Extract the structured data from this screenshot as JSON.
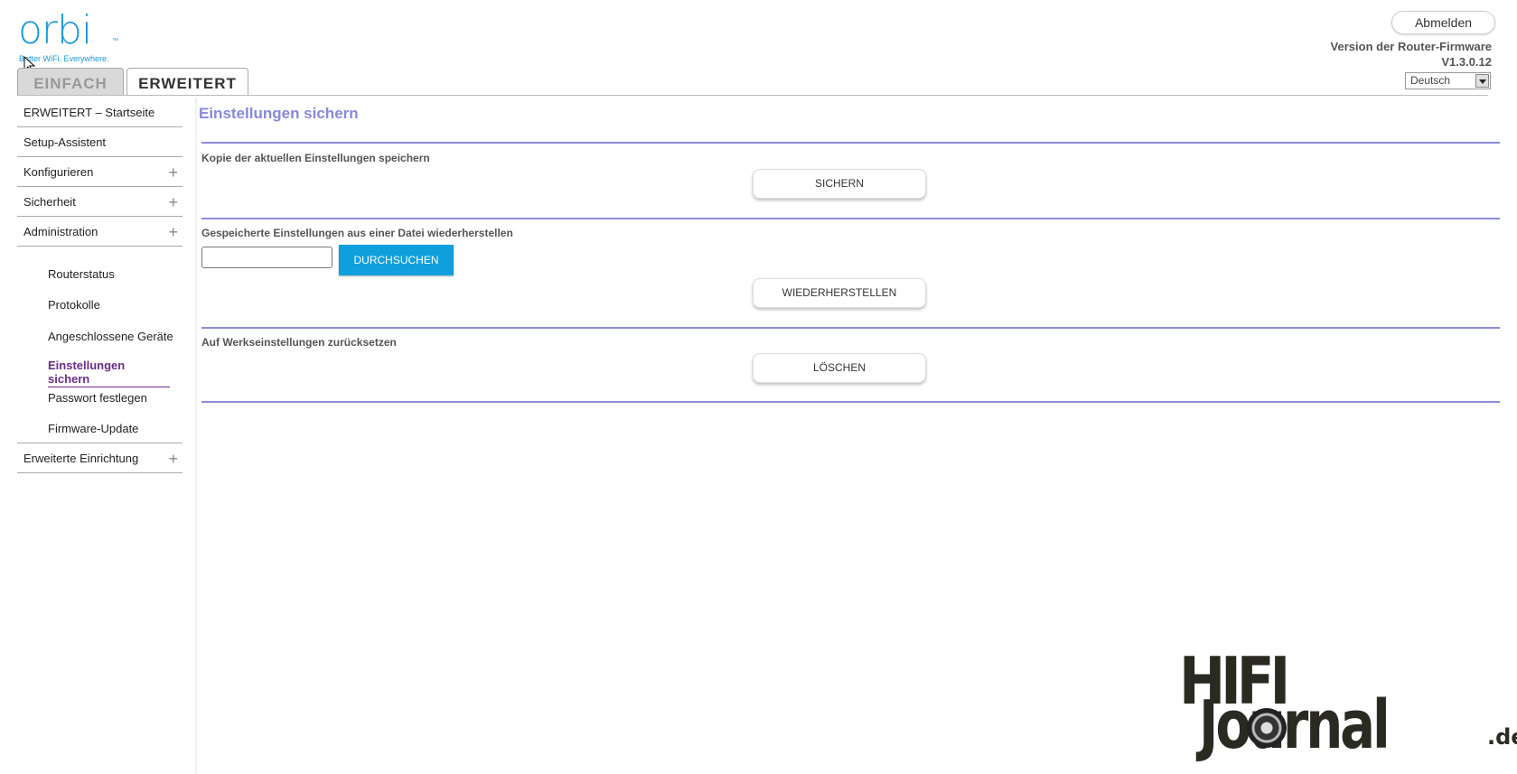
{
  "header": {
    "logo_text": "orbi",
    "logo_tm": "™",
    "logo_tagline": "Better WiFi. Everywhere.",
    "tabs": [
      {
        "label": "EINFACH",
        "active": false
      },
      {
        "label": "ERWEITERT",
        "active": true
      }
    ],
    "logout_label": "Abmelden",
    "firmware_label": "Version der Router-Firmware",
    "firmware_version": "V1.3.0.12",
    "language_selected": "Deutsch"
  },
  "sidebar": {
    "items": [
      {
        "label": "ERWEITERT – Startseite",
        "expandable": false
      },
      {
        "label": "Setup-Assistent",
        "expandable": false
      },
      {
        "label": "Konfigurieren",
        "expandable": true
      },
      {
        "label": "Sicherheit",
        "expandable": true
      },
      {
        "label": "Administration",
        "expandable": true
      }
    ],
    "admin_subitems": [
      {
        "label": "Routerstatus"
      },
      {
        "label": "Protokolle"
      },
      {
        "label": "Angeschlossene Geräte"
      },
      {
        "label_line1": "Einstellungen",
        "label_line2": "sichern",
        "active": true
      },
      {
        "label": "Passwort festlegen"
      },
      {
        "label": "Firmware-Update"
      }
    ],
    "bottom_item": {
      "label": "Erweiterte Einrichtung",
      "expandable": true
    },
    "expand_symbol": "+"
  },
  "main": {
    "title": "Einstellungen sichern",
    "backup": {
      "label": "Kopie der aktuellen Einstellungen speichern",
      "button": "SICHERN"
    },
    "restore": {
      "label": "Gespeicherte Einstellungen aus einer Datei wiederherstellen",
      "file_value": "",
      "browse_button": "DURCHSUCHEN",
      "restore_button": "WIEDERHERSTELLEN"
    },
    "reset": {
      "label": "Auf Werkseinstellungen zurücksetzen",
      "button": "LÖSCHEN"
    }
  },
  "watermark": {
    "line1": "HIFI",
    "line2": "Journal",
    "suffix": ".de"
  },
  "colors": {
    "brand_blue": "#1a9ad6",
    "accent_purple": "#8c8cd8",
    "active_nav": "#6a2e8a",
    "browse_button": "#0e9fdc"
  }
}
